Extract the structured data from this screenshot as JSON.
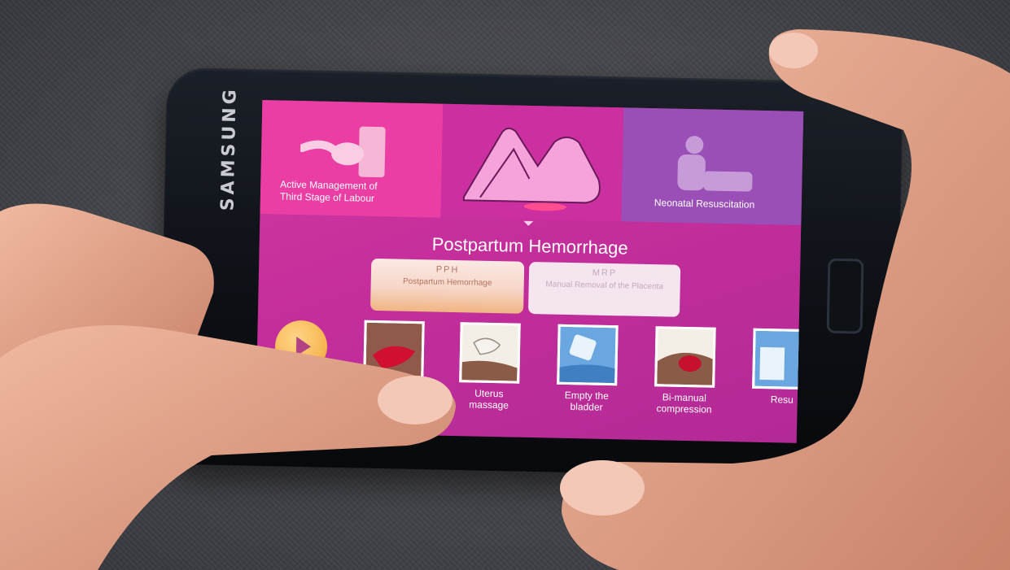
{
  "device": {
    "brand": "SAMSUNG"
  },
  "app": {
    "top_tiles": [
      {
        "label": "Active Management of Third Stage of Labour"
      },
      {
        "label": ""
      },
      {
        "label": "Neonatal Resuscitation"
      }
    ],
    "section_title": "Postpartum Hemorrhage",
    "tabs": [
      {
        "abbr": "PPH",
        "name": "Postpartum Hemorrhage",
        "selected": true
      },
      {
        "abbr": "MRP",
        "name": "Manual Removal of the Placenta",
        "selected": false
      }
    ],
    "play_all_label": "Play all",
    "steps": [
      {
        "label": "",
        "icon": "bleeding-icon"
      },
      {
        "label": "Uterus massage",
        "icon": "massage-icon"
      },
      {
        "label": "Empty the bladder",
        "icon": "bladder-icon"
      },
      {
        "label": "Bi-manual compression",
        "icon": "compression-icon"
      },
      {
        "label": "Resu",
        "icon": "resuscitation-icon"
      }
    ]
  },
  "colors": {
    "screen_bg": "#c42e9b",
    "amtsl_tile": "#ea3ea5",
    "neonatal_tile": "#9a4fb6",
    "play_button": "#f7b956"
  }
}
